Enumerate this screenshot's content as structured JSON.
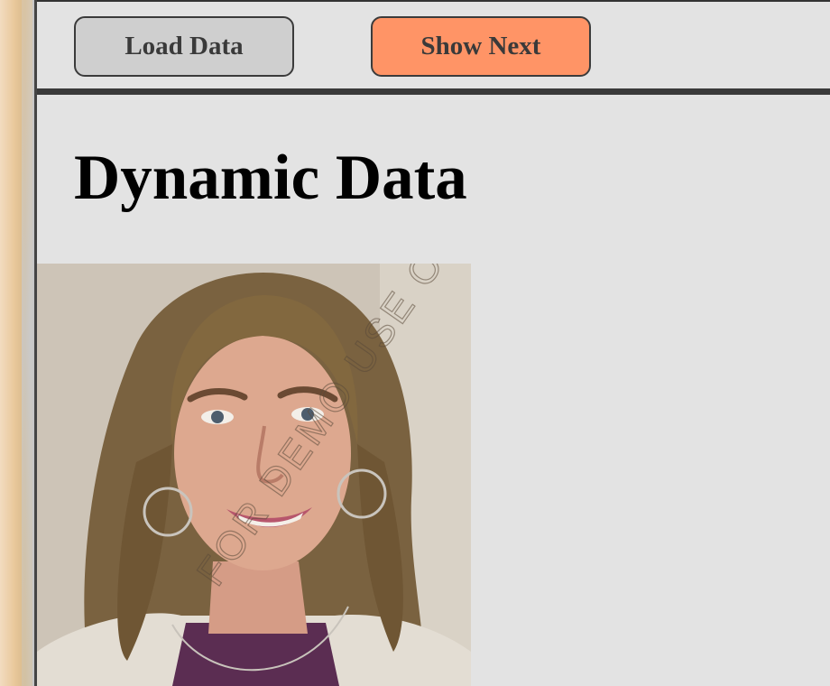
{
  "toolbar": {
    "load_button_label": "Load Data",
    "next_button_label": "Show Next",
    "colors": {
      "load_button": "#cfcfcf",
      "next_button": "#ff9466"
    }
  },
  "main": {
    "title": "Dynamic Data",
    "image": {
      "description": "portrait-photo",
      "watermark_text": "FOR DEMO USE ONLY"
    }
  }
}
